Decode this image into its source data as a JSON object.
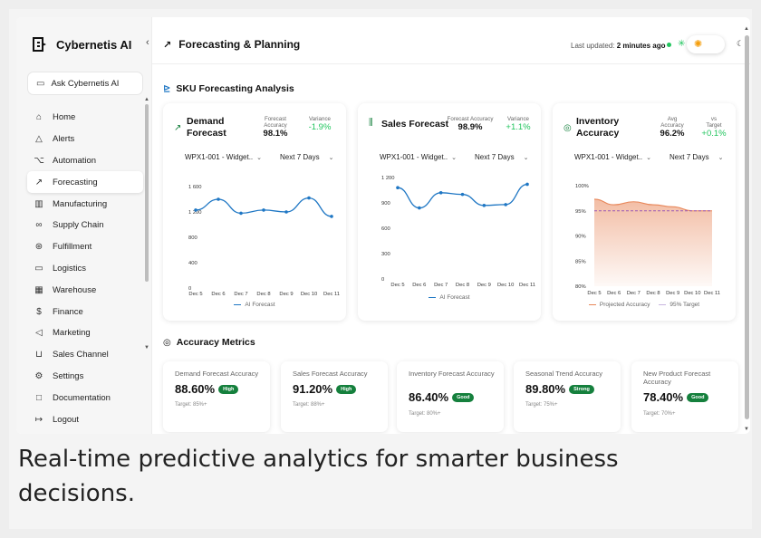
{
  "sidebar": {
    "brand": "Cybernetis AI",
    "ask_label": "Ask Cybernetis AI",
    "items": [
      {
        "label": "Home",
        "icon": "home-icon"
      },
      {
        "label": "Alerts",
        "icon": "alert-triangle-icon"
      },
      {
        "label": "Automation",
        "icon": "automation-icon"
      },
      {
        "label": "Forecasting",
        "icon": "trend-icon"
      },
      {
        "label": "Manufacturing",
        "icon": "factory-icon"
      },
      {
        "label": "Supply Chain",
        "icon": "link-icon"
      },
      {
        "label": "Fulfillment",
        "icon": "package-icon"
      },
      {
        "label": "Logistics",
        "icon": "truck-icon"
      },
      {
        "label": "Warehouse",
        "icon": "warehouse-icon"
      },
      {
        "label": "Finance",
        "icon": "dollar-icon"
      },
      {
        "label": "Marketing",
        "icon": "megaphone-icon"
      },
      {
        "label": "Sales Channel",
        "icon": "cart-icon"
      },
      {
        "label": "Settings",
        "icon": "gear-icon"
      },
      {
        "label": "Documentation",
        "icon": "book-icon"
      },
      {
        "label": "Logout",
        "icon": "logout-icon"
      }
    ],
    "active_item": "Forecasting"
  },
  "header": {
    "title": "Forecasting & Planning",
    "updated_label": "Last updated:",
    "updated_value": "2 minutes ago"
  },
  "sku_section": {
    "title": "SKU Forecasting Analysis"
  },
  "cards": [
    {
      "title_line1": "Demand",
      "title_line2": "Forecast",
      "metric1_label_1": "Forecast",
      "metric1_label_2": "Accuracy",
      "metric1_value": "98.1%",
      "metric2_label": "Variance",
      "metric2_value": "-1.9%",
      "sku": "WPX1-001 - Widget..",
      "range": "Next 7 Days",
      "legend": "AI Forecast"
    },
    {
      "title_line1": "Sales Forecast",
      "title_line2": "",
      "metric1_label_1": "Forecast Accuracy",
      "metric1_label_2": "",
      "metric1_value": "98.9%",
      "metric2_label": "Variance",
      "metric2_value": "+1.1%",
      "sku": "WPX1-001 - Widget..",
      "range": "Next 7 Days",
      "legend": "AI Forecast"
    },
    {
      "title_line1": "Inventory",
      "title_line2": "Accuracy",
      "metric1_label_1": "Avg",
      "metric1_label_2": "Accuracy",
      "metric1_value": "96.2%",
      "metric2_label_1": "vs",
      "metric2_label": "Target",
      "metric2_value": "+0.1%",
      "sku": "WPX1-001 - Widget..",
      "range": "Next 7 Days",
      "legend": "Projected Accuracy",
      "legend2": "95% Target"
    }
  ],
  "chart_data": [
    {
      "type": "line",
      "x": [
        "Dec 5",
        "Dec 6",
        "Dec 7",
        "Dec 8",
        "Dec 9",
        "Dec 10",
        "Dec 11"
      ],
      "series": [
        {
          "name": "AI Forecast",
          "values": [
            1230,
            1400,
            1180,
            1230,
            1200,
            1420,
            1130
          ]
        }
      ],
      "yticks": [
        "0",
        "400",
        "800",
        "1 200",
        "1 600"
      ],
      "ylim": [
        0,
        1600
      ],
      "color": "#1f77c4"
    },
    {
      "type": "line",
      "x": [
        "Dec 5",
        "Dec 6",
        "Dec 7",
        "Dec 8",
        "Dec 9",
        "Dec 10",
        "Dec 11"
      ],
      "series": [
        {
          "name": "AI Forecast",
          "values": [
            1080,
            840,
            1020,
            1000,
            870,
            880,
            1120
          ]
        }
      ],
      "yticks": [
        "0",
        "300",
        "600",
        "900",
        "1 200"
      ],
      "ylim": [
        0,
        1200
      ],
      "color": "#1f77c4"
    },
    {
      "type": "area",
      "x": [
        "Dec 5",
        "Dec 6",
        "Dec 7",
        "Dec 8",
        "Dec 9",
        "Dec 10",
        "Dec 11"
      ],
      "series": [
        {
          "name": "Projected Accuracy",
          "values": [
            97.3,
            96.2,
            96.8,
            96.2,
            95.8,
            95.0,
            95.0
          ]
        },
        {
          "name": "95% Target",
          "values": [
            95,
            95,
            95,
            95,
            95,
            95,
            95
          ]
        }
      ],
      "yticks": [
        "80%",
        "85%",
        "90%",
        "95%",
        "100%"
      ],
      "ylim": [
        80,
        100
      ],
      "color": "#e8875a",
      "target_color": "#9b59b6"
    }
  ],
  "accuracy_section": {
    "title": "Accuracy Metrics"
  },
  "metrics": [
    {
      "label": "Demand Forecast Accuracy",
      "value": "88.60%",
      "badge": "High",
      "target": "Target: 85%+"
    },
    {
      "label": "Sales Forecast Accuracy",
      "value": "91.20%",
      "badge": "High",
      "target": "Target: 88%+"
    },
    {
      "label": "Inventory Forecast Accuracy",
      "value": "86.40%",
      "badge": "Good",
      "target": "Target: 80%+"
    },
    {
      "label": "Seasonal Trend Accuracy",
      "value": "89.80%",
      "badge": "Strong",
      "target": "Target: 75%+"
    },
    {
      "label": "New Product Forecast Accuracy",
      "value": "78.40%",
      "badge": "Good",
      "target": "Target: 70%+"
    }
  ],
  "caption": "Real-time predictive analytics for smarter business decisions.",
  "colors": {
    "accent_green": "#22c55e",
    "badge_green": "#15803d",
    "line_blue": "#1f77c4",
    "area_orange": "#e8875a"
  }
}
